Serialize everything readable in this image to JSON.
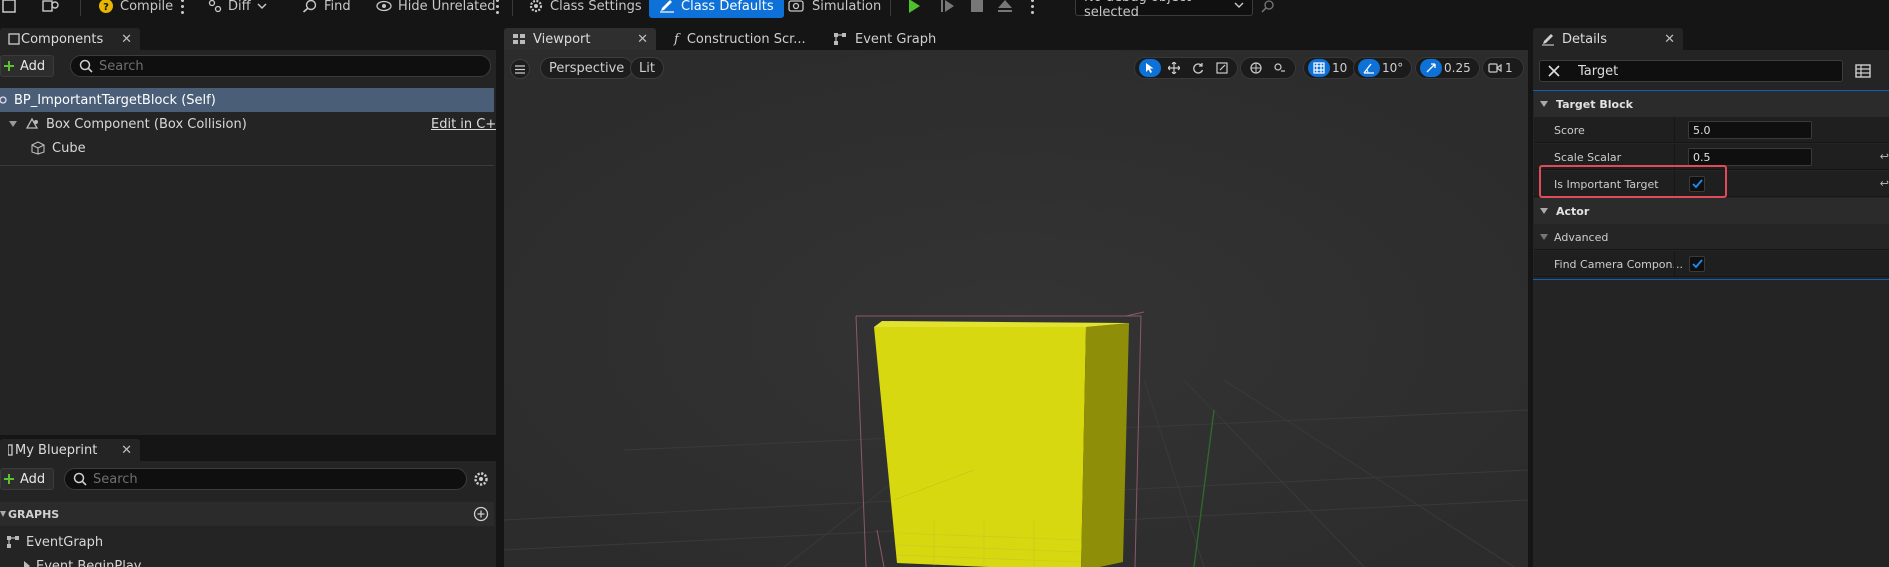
{
  "toolbar": {
    "compile_label": "Compile",
    "diff_label": "Diff",
    "find_label": "Find",
    "hide_unrelated_label": "Hide Unrelated",
    "class_settings_label": "Class Settings",
    "class_defaults_label": "Class Defaults",
    "simulation_label": "Simulation",
    "debug_object_label": "No debug object selected"
  },
  "components": {
    "tab_label": "Components",
    "add_label": "Add",
    "search_placeholder": "Search",
    "root_item": "BP_ImportantTargetBlock (Self)",
    "box_component": "Box Component (Box Collision)",
    "edit_cpp": "Edit in C++",
    "cube": "Cube"
  },
  "my_blueprint": {
    "tab_label": "My Blueprint",
    "add_label": "Add",
    "search_placeholder": "Search",
    "graphs_header": "GRAPHS",
    "event_graph": "EventGraph",
    "event_begin_play": "Event BeginPlay"
  },
  "editor_tabs": {
    "viewport": "Viewport",
    "construction": "Construction Scr...",
    "event_graph": "Event Graph"
  },
  "viewport": {
    "perspective": "Perspective",
    "lit": "Lit",
    "grid_snap": "10",
    "rotation_snap": "10°",
    "scale_snap": "0.25",
    "camera_speed": "1"
  },
  "details": {
    "tab_label": "Details",
    "search_value": "Target",
    "section_target_block": "Target Block",
    "score_label": "Score",
    "score_value": "5.0",
    "scale_scalar_label": "Scale Scalar",
    "scale_scalar_value": "0.5",
    "is_important_label": "Is Important Target",
    "section_actor": "Actor",
    "advanced_label": "Advanced",
    "find_camera_label": "Find Camera Compon..."
  },
  "colors": {
    "accent": "#0e71d8",
    "highlight_box": "#e04b5a",
    "cube": "#d8d810"
  }
}
